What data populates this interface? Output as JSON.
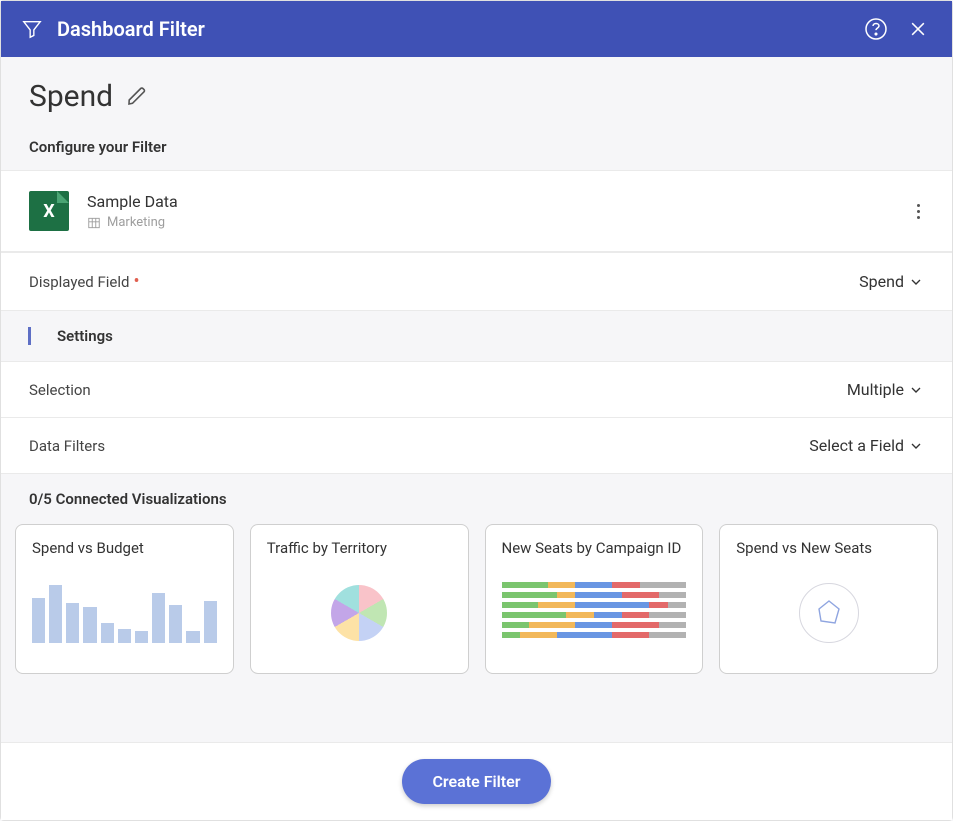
{
  "header": {
    "title": "Dashboard Filter"
  },
  "filter_name": "Spend",
  "section_label": "Configure your Filter",
  "datasource": {
    "icon_letter": "X",
    "name": "Sample Data",
    "table": "Marketing"
  },
  "displayed_field": {
    "label": "Displayed Field",
    "value": "Spend"
  },
  "settings_label": "Settings",
  "selection": {
    "label": "Selection",
    "value": "Multiple"
  },
  "data_filters": {
    "label": "Data Filters",
    "value": "Select a Field"
  },
  "visualizations": {
    "header": "0/5 Connected Visualizations",
    "cards": [
      {
        "title": "Spend vs Budget",
        "type": "bar"
      },
      {
        "title": "Traffic by Territory",
        "type": "pie"
      },
      {
        "title": "New Seats by Campaign ID",
        "type": "hbar"
      },
      {
        "title": "Spend vs New Seats",
        "type": "radar"
      }
    ]
  },
  "footer": {
    "create_label": "Create Filter"
  }
}
